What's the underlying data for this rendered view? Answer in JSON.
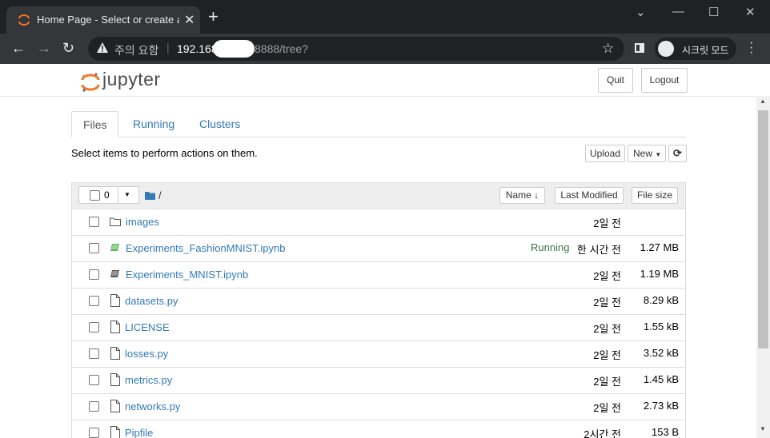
{
  "browser": {
    "tab_title": "Home Page - Select or create a notebook",
    "new_tab": "+",
    "security_label": "주의 요함",
    "url_host": "192.168",
    "url_path": "8888/tree?",
    "incognito_label": "시크릿 모드",
    "controls": {
      "minimize": "—",
      "maximize": "☐",
      "close": "✕",
      "chevron": "⌄"
    }
  },
  "header": {
    "logo_text": "jupyter",
    "quit_label": "Quit",
    "logout_label": "Logout"
  },
  "tabs": [
    {
      "label": "Files",
      "active": true
    },
    {
      "label": "Running",
      "active": false
    },
    {
      "label": "Clusters",
      "active": false
    }
  ],
  "actions": {
    "hint": "Select items to perform actions on them.",
    "upload_label": "Upload",
    "new_label": "New",
    "refresh_icon": "refresh-icon"
  },
  "list_header": {
    "selected_count": "0",
    "breadcrumb": "/",
    "name_label": "Name",
    "last_modified_label": "Last Modified",
    "file_size_label": "File size"
  },
  "items": [
    {
      "name": "images",
      "type": "folder",
      "status": "",
      "modified": "2일 전",
      "size": ""
    },
    {
      "name": "Experiments_FashionMNIST.ipynb",
      "type": "notebook-running",
      "status": "Running",
      "modified": "한 시간 전",
      "size": "1.27 MB"
    },
    {
      "name": "Experiments_MNIST.ipynb",
      "type": "notebook",
      "status": "",
      "modified": "2일 전",
      "size": "1.19 MB"
    },
    {
      "name": "datasets.py",
      "type": "file",
      "status": "",
      "modified": "2일 전",
      "size": "8.29 kB"
    },
    {
      "name": "LICENSE",
      "type": "file",
      "status": "",
      "modified": "2일 전",
      "size": "1.55 kB"
    },
    {
      "name": "losses.py",
      "type": "file",
      "status": "",
      "modified": "2일 전",
      "size": "3.52 kB"
    },
    {
      "name": "metrics.py",
      "type": "file",
      "status": "",
      "modified": "2일 전",
      "size": "1.45 kB"
    },
    {
      "name": "networks.py",
      "type": "file",
      "status": "",
      "modified": "2일 전",
      "size": "2.73 kB"
    },
    {
      "name": "Pipfile",
      "type": "file",
      "status": "",
      "modified": "2시간 전",
      "size": "153 B"
    }
  ],
  "colors": {
    "link": "#337ab7",
    "running": "#3c763d",
    "jupyter_orange": "#f37726"
  }
}
